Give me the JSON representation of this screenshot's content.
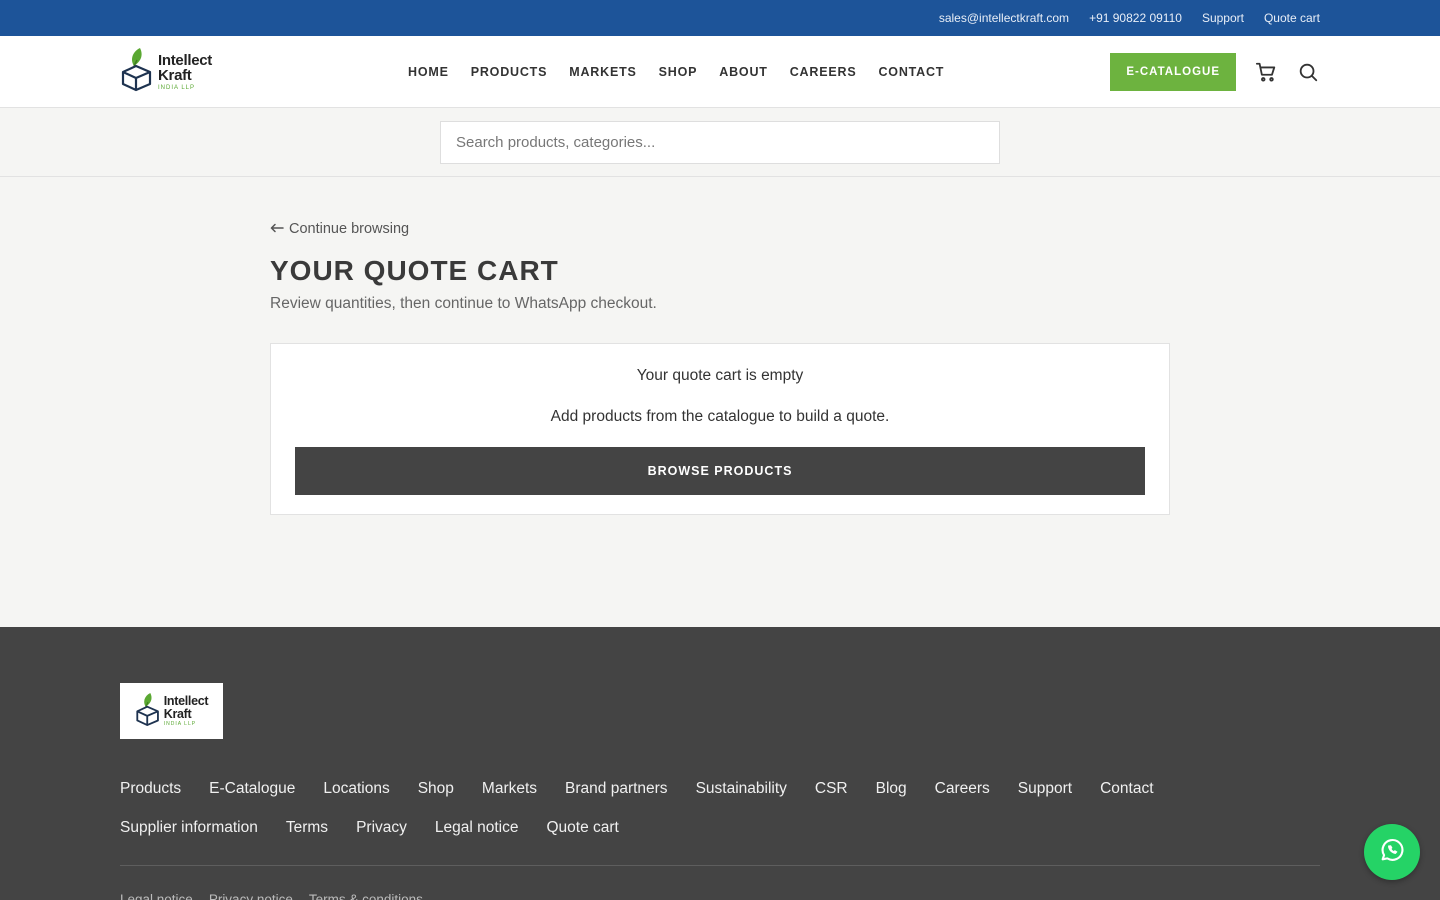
{
  "topbar": {
    "email": "sales@intellectkraft.com",
    "phone": "+91 90822 09110",
    "support": "Support",
    "quote_cart": "Quote cart"
  },
  "logo": {
    "line1": "Intellect",
    "line2": "Kraft",
    "line3": "INDIA LLP",
    "icon": "box-leaf-icon"
  },
  "nav": {
    "items": [
      {
        "label": "HOME"
      },
      {
        "label": "PRODUCTS"
      },
      {
        "label": "MARKETS"
      },
      {
        "label": "SHOP"
      },
      {
        "label": "ABOUT"
      },
      {
        "label": "CAREERS"
      },
      {
        "label": "CONTACT"
      }
    ]
  },
  "header": {
    "ecatalogue_label": "E-CATALOGUE",
    "cart_icon": "cart-icon",
    "search_icon": "search-icon"
  },
  "search": {
    "placeholder": "Search products, categories..."
  },
  "main": {
    "back_link": "Continue browsing",
    "title": "YOUR QUOTE CART",
    "subtitle": "Review quantities, then continue to WhatsApp checkout.",
    "empty_title": "Your quote cart is empty",
    "empty_text": "Add products from the catalogue to build a quote.",
    "browse_label": "BROWSE PRODUCTS"
  },
  "footer": {
    "links": [
      "Products",
      "E-Catalogue",
      "Locations",
      "Shop",
      "Markets",
      "Brand partners",
      "Sustainability",
      "CSR",
      "Blog",
      "Careers",
      "Support",
      "Contact",
      "Supplier information",
      "Terms",
      "Privacy",
      "Legal notice",
      "Quote cart"
    ],
    "bottom_links": [
      "Legal notice",
      "Privacy notice",
      "Terms & conditions"
    ]
  },
  "colors": {
    "topbar": "#1d5499",
    "accent_green": "#6db33f",
    "footer": "#444444",
    "whatsapp": "#25d366"
  }
}
